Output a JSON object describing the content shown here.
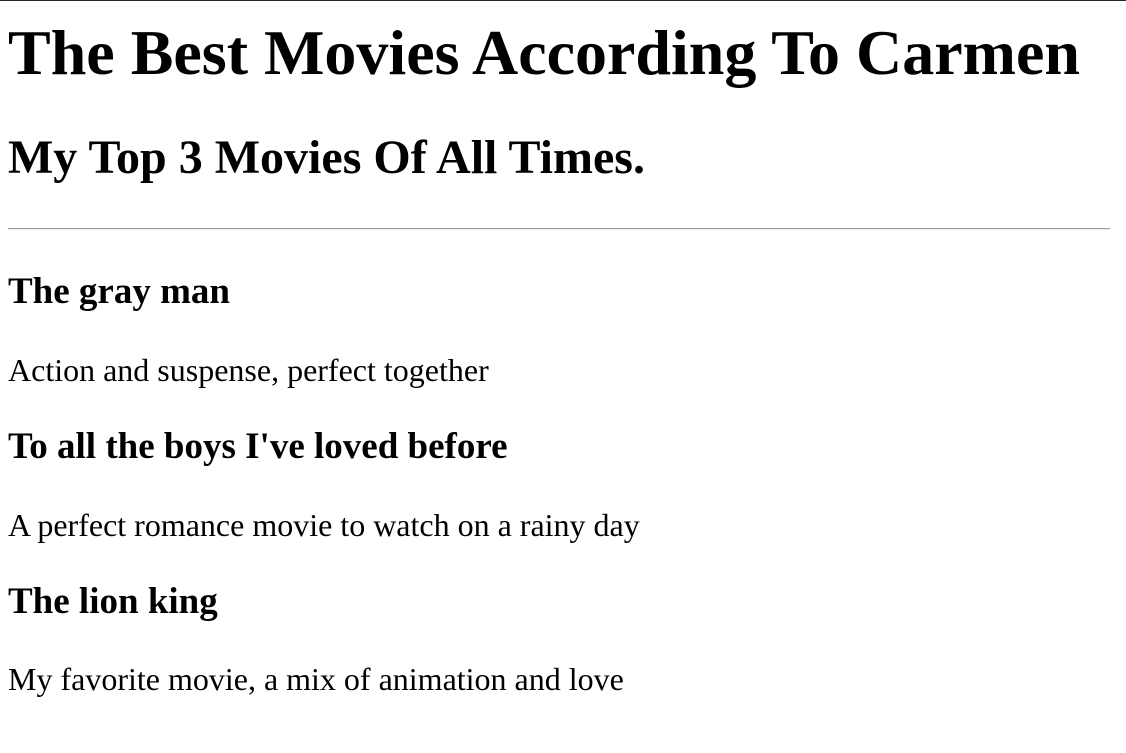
{
  "page": {
    "title": "The Best Movies According To Carmen",
    "subtitle": "My Top 3 Movies Of All Times."
  },
  "movies": [
    {
      "title": "The gray man",
      "description": "Action and suspense, perfect together"
    },
    {
      "title": "To all the boys I've loved before",
      "description": "A perfect romance movie to watch on a rainy day"
    },
    {
      "title": "The lion king",
      "description": "My favorite movie, a mix of animation and love"
    }
  ]
}
